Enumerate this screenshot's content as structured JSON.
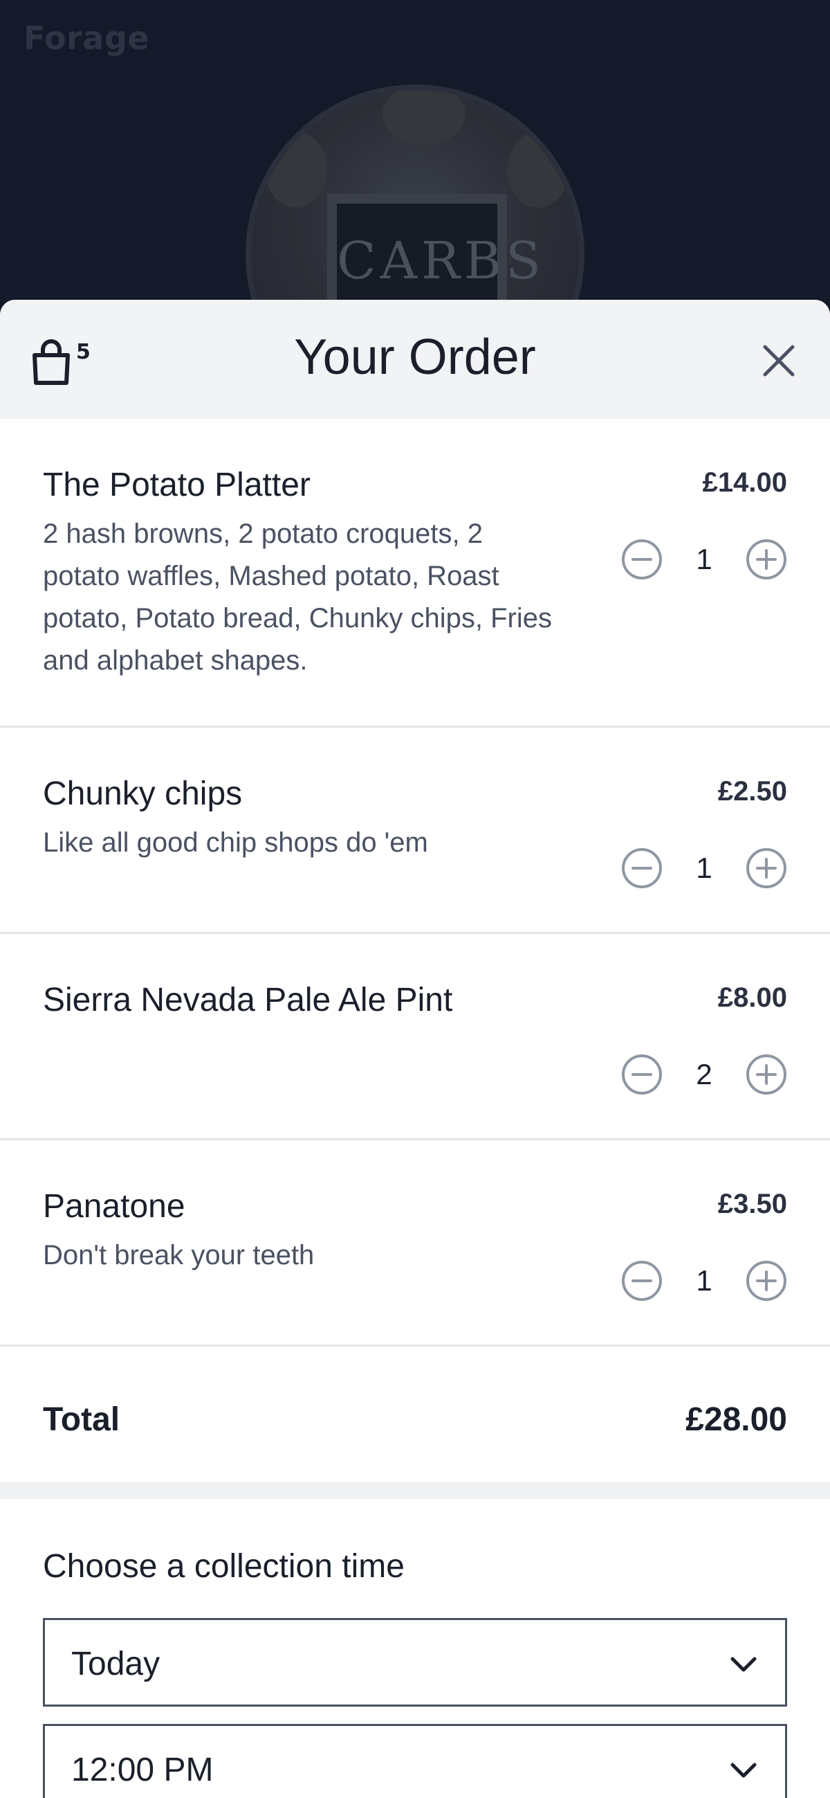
{
  "backdrop": {
    "brand": "Forage",
    "hero_text": "CARBS"
  },
  "order": {
    "title": "Your Order",
    "bag_count": "5",
    "items": [
      {
        "name": "The Potato Platter",
        "description": "2 hash browns, 2 potato croquets, 2 potato waffles, Mashed potato, Roast potato, Potato bread, Chunky chips, Fries and alphabet shapes.",
        "price": "£14.00",
        "quantity": "1"
      },
      {
        "name": "Chunky chips",
        "description": "Like all good chip shops do 'em",
        "price": "£2.50",
        "quantity": "1"
      },
      {
        "name": "Sierra Nevada Pale Ale Pint",
        "description": "",
        "price": "£8.00",
        "quantity": "2"
      },
      {
        "name": "Panatone",
        "description": "Don't break your teeth",
        "price": "£3.50",
        "quantity": "1"
      }
    ],
    "total_label": "Total",
    "total_value": "£28.00"
  },
  "collection": {
    "label": "Choose a collection time",
    "day": "Today",
    "time": "12:00 PM"
  },
  "icons": {
    "bag": "shopping-bag-icon",
    "close": "close-icon",
    "minus": "minus-circle-icon",
    "plus": "plus-circle-icon",
    "chevron": "chevron-down-icon"
  },
  "colors": {
    "backdrop": "#141a29",
    "header_bg": "#f2f3f5",
    "stepper_icon": "#8f96a3",
    "text": "#1a1f2b"
  }
}
